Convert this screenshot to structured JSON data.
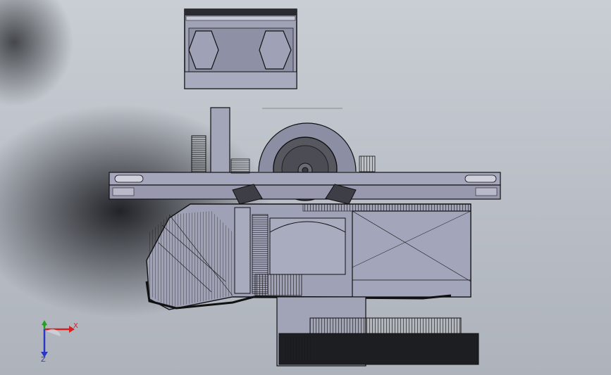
{
  "viewport": {
    "background_gradient": [
      "#c9ced4",
      "#aeb3bb"
    ],
    "model_color": "#9a9cb2",
    "edge_color": "#101012"
  },
  "triad": {
    "x_label": "X",
    "y_label": "Y",
    "z_label": "Z",
    "x_color": "#d42020",
    "y_color": "#1fa31f",
    "z_color": "#2a36c8"
  }
}
